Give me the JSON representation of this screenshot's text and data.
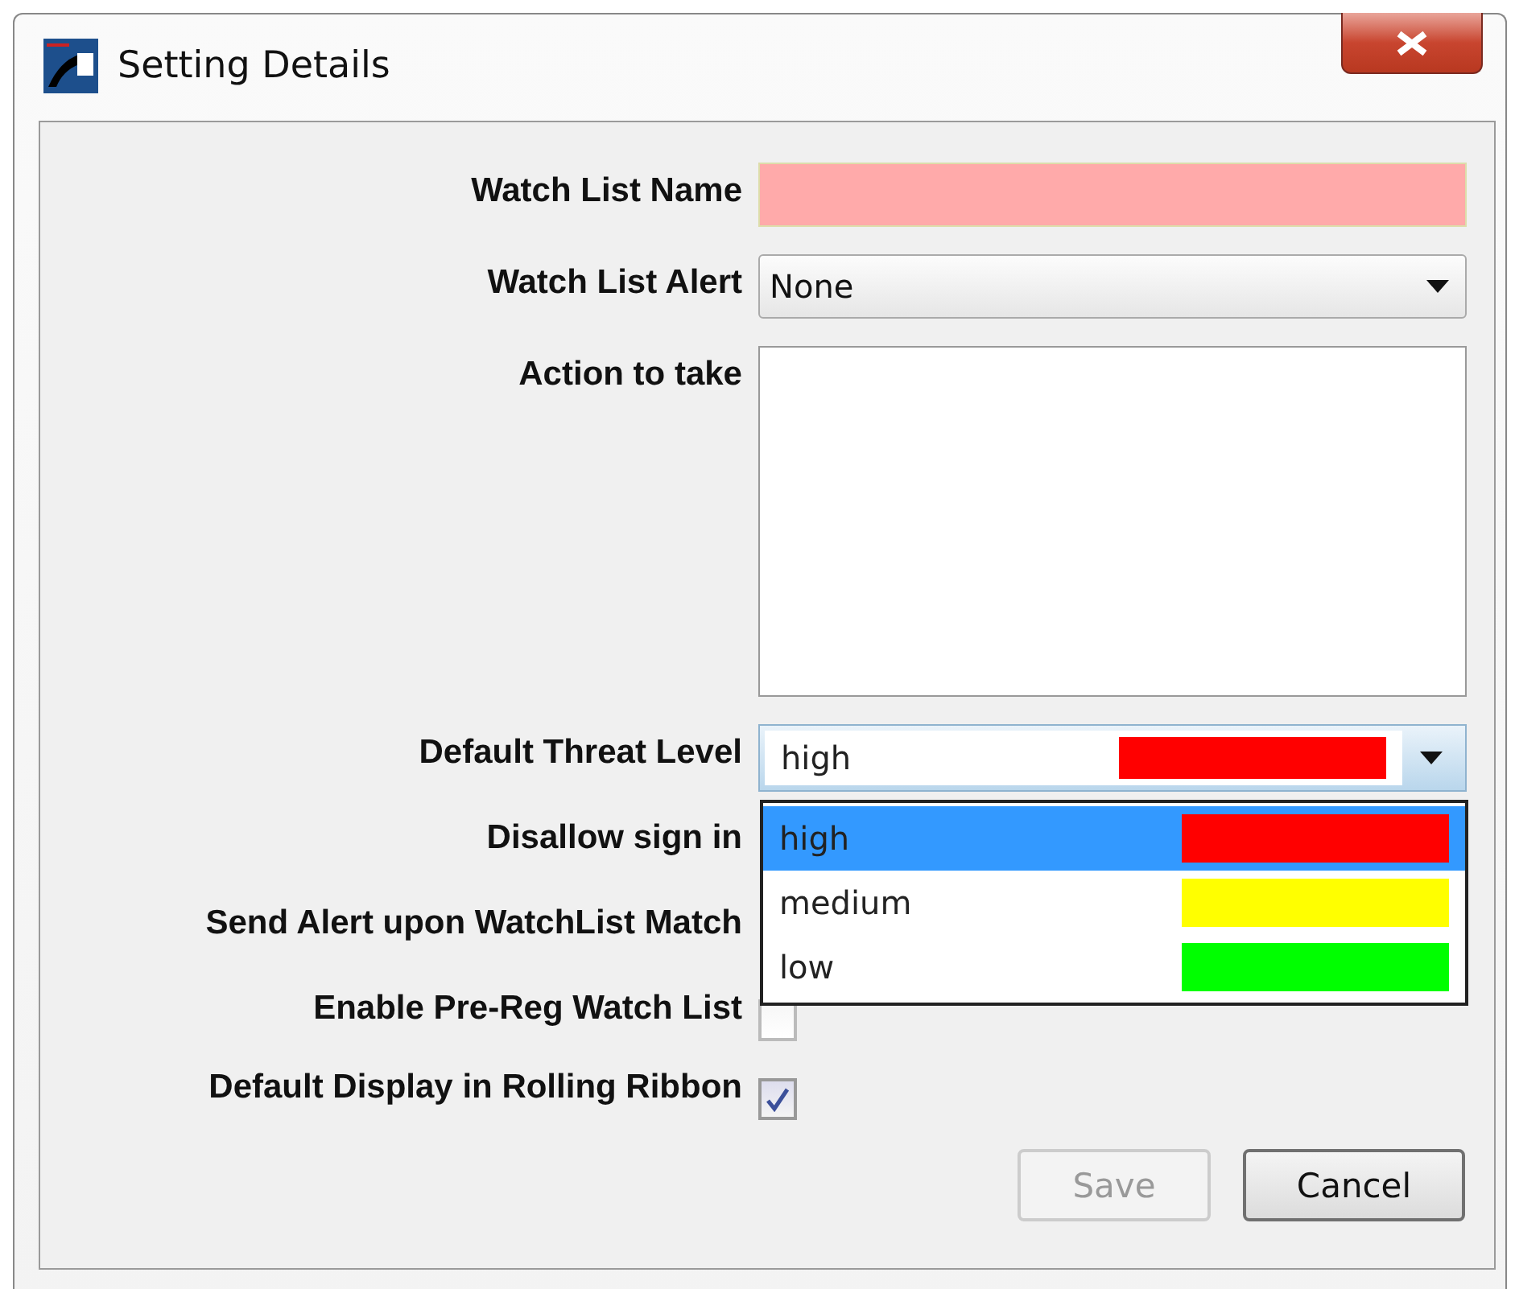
{
  "window": {
    "title": "Setting Details"
  },
  "fields": [
    {
      "kind": "text",
      "label": "Watch List Name",
      "invalid": true
    },
    {
      "kind": "select",
      "label": "Watch List Alert",
      "value": "None"
    },
    {
      "kind": "textarea",
      "label": "Action to take"
    },
    {
      "kind": "colorselect",
      "label": "Default Threat Level",
      "value": "high",
      "color": "#ff0000",
      "expanded": true,
      "options": [
        {
          "label": "high",
          "color": "#ff0000",
          "selected": true
        },
        {
          "label": "medium",
          "color": "#ffff00",
          "selected": false
        },
        {
          "label": "low",
          "color": "#00ff00",
          "selected": false
        }
      ]
    },
    {
      "kind": "covered",
      "label": "Disallow sign in"
    },
    {
      "kind": "covered",
      "label": "Send Alert upon WatchList Match"
    },
    {
      "kind": "checkbox",
      "label": "Enable Pre-Reg Watch List",
      "checked": false
    },
    {
      "kind": "checkbox",
      "label": "Default Display in Rolling Ribbon",
      "checked": true
    }
  ],
  "buttons": [
    {
      "label": "Save",
      "disabled": true
    },
    {
      "label": "Cancel",
      "disabled": false
    }
  ]
}
